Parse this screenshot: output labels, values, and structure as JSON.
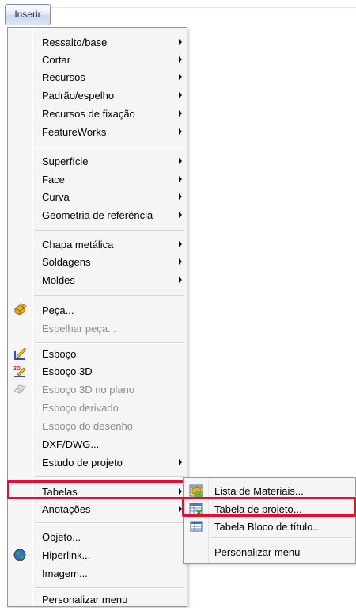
{
  "menubar": {
    "insert_label": "Inserir"
  },
  "menu": {
    "items": [
      {
        "label": "Ressalto/base",
        "submenu": true
      },
      {
        "label": "Cortar",
        "submenu": true
      },
      {
        "label": "Recursos",
        "submenu": true
      },
      {
        "label": "Padrão/espelho",
        "submenu": true
      },
      {
        "label": "Recursos de fixação",
        "submenu": true
      },
      {
        "label": "FeatureWorks",
        "submenu": true
      },
      {
        "label": "Superfície",
        "submenu": true
      },
      {
        "label": "Face",
        "submenu": true
      },
      {
        "label": "Curva",
        "submenu": true
      },
      {
        "label": "Geometria de referência",
        "submenu": true
      },
      {
        "label": "Chapa metálica",
        "submenu": true
      },
      {
        "label": "Soldagens",
        "submenu": true
      },
      {
        "label": "Moldes",
        "submenu": true
      },
      {
        "label": "Peça...",
        "icon": "part-icon"
      },
      {
        "label": "Espelhar peça...",
        "disabled": true
      },
      {
        "label": "Esboço",
        "icon": "sketch-icon"
      },
      {
        "label": "Esboço 3D",
        "icon": "sketch-3d-icon"
      },
      {
        "label": "Esboço 3D no plano",
        "icon": "sketch-3d-plane-icon",
        "disabled": true
      },
      {
        "label": "Esboço derivado",
        "disabled": true
      },
      {
        "label": "Esboço do desenho",
        "disabled": true
      },
      {
        "label": "DXF/DWG..."
      },
      {
        "label": "Estudo de projeto",
        "submenu": true
      },
      {
        "label": "Tabelas",
        "submenu": true,
        "highlighted": true
      },
      {
        "label": "Anotações",
        "submenu": true
      },
      {
        "label": "Objeto..."
      },
      {
        "label": "Hiperlink...",
        "icon": "hyperlink-globe-icon"
      },
      {
        "label": "Imagem..."
      },
      {
        "label": "Personalizar menu"
      }
    ]
  },
  "submenu": {
    "items": [
      {
        "label": "Lista de Materiais...",
        "icon": "bill-of-materials-icon"
      },
      {
        "label": "Tabela de projeto...",
        "icon": "design-table-icon",
        "highlighted": true
      },
      {
        "label": "Tabela Bloco de título...",
        "icon": "title-block-table-icon"
      },
      {
        "label": "Personalizar menu"
      }
    ]
  },
  "colors": {
    "highlight_border": "#e0102e",
    "menu_background": "#f5f5f5"
  }
}
